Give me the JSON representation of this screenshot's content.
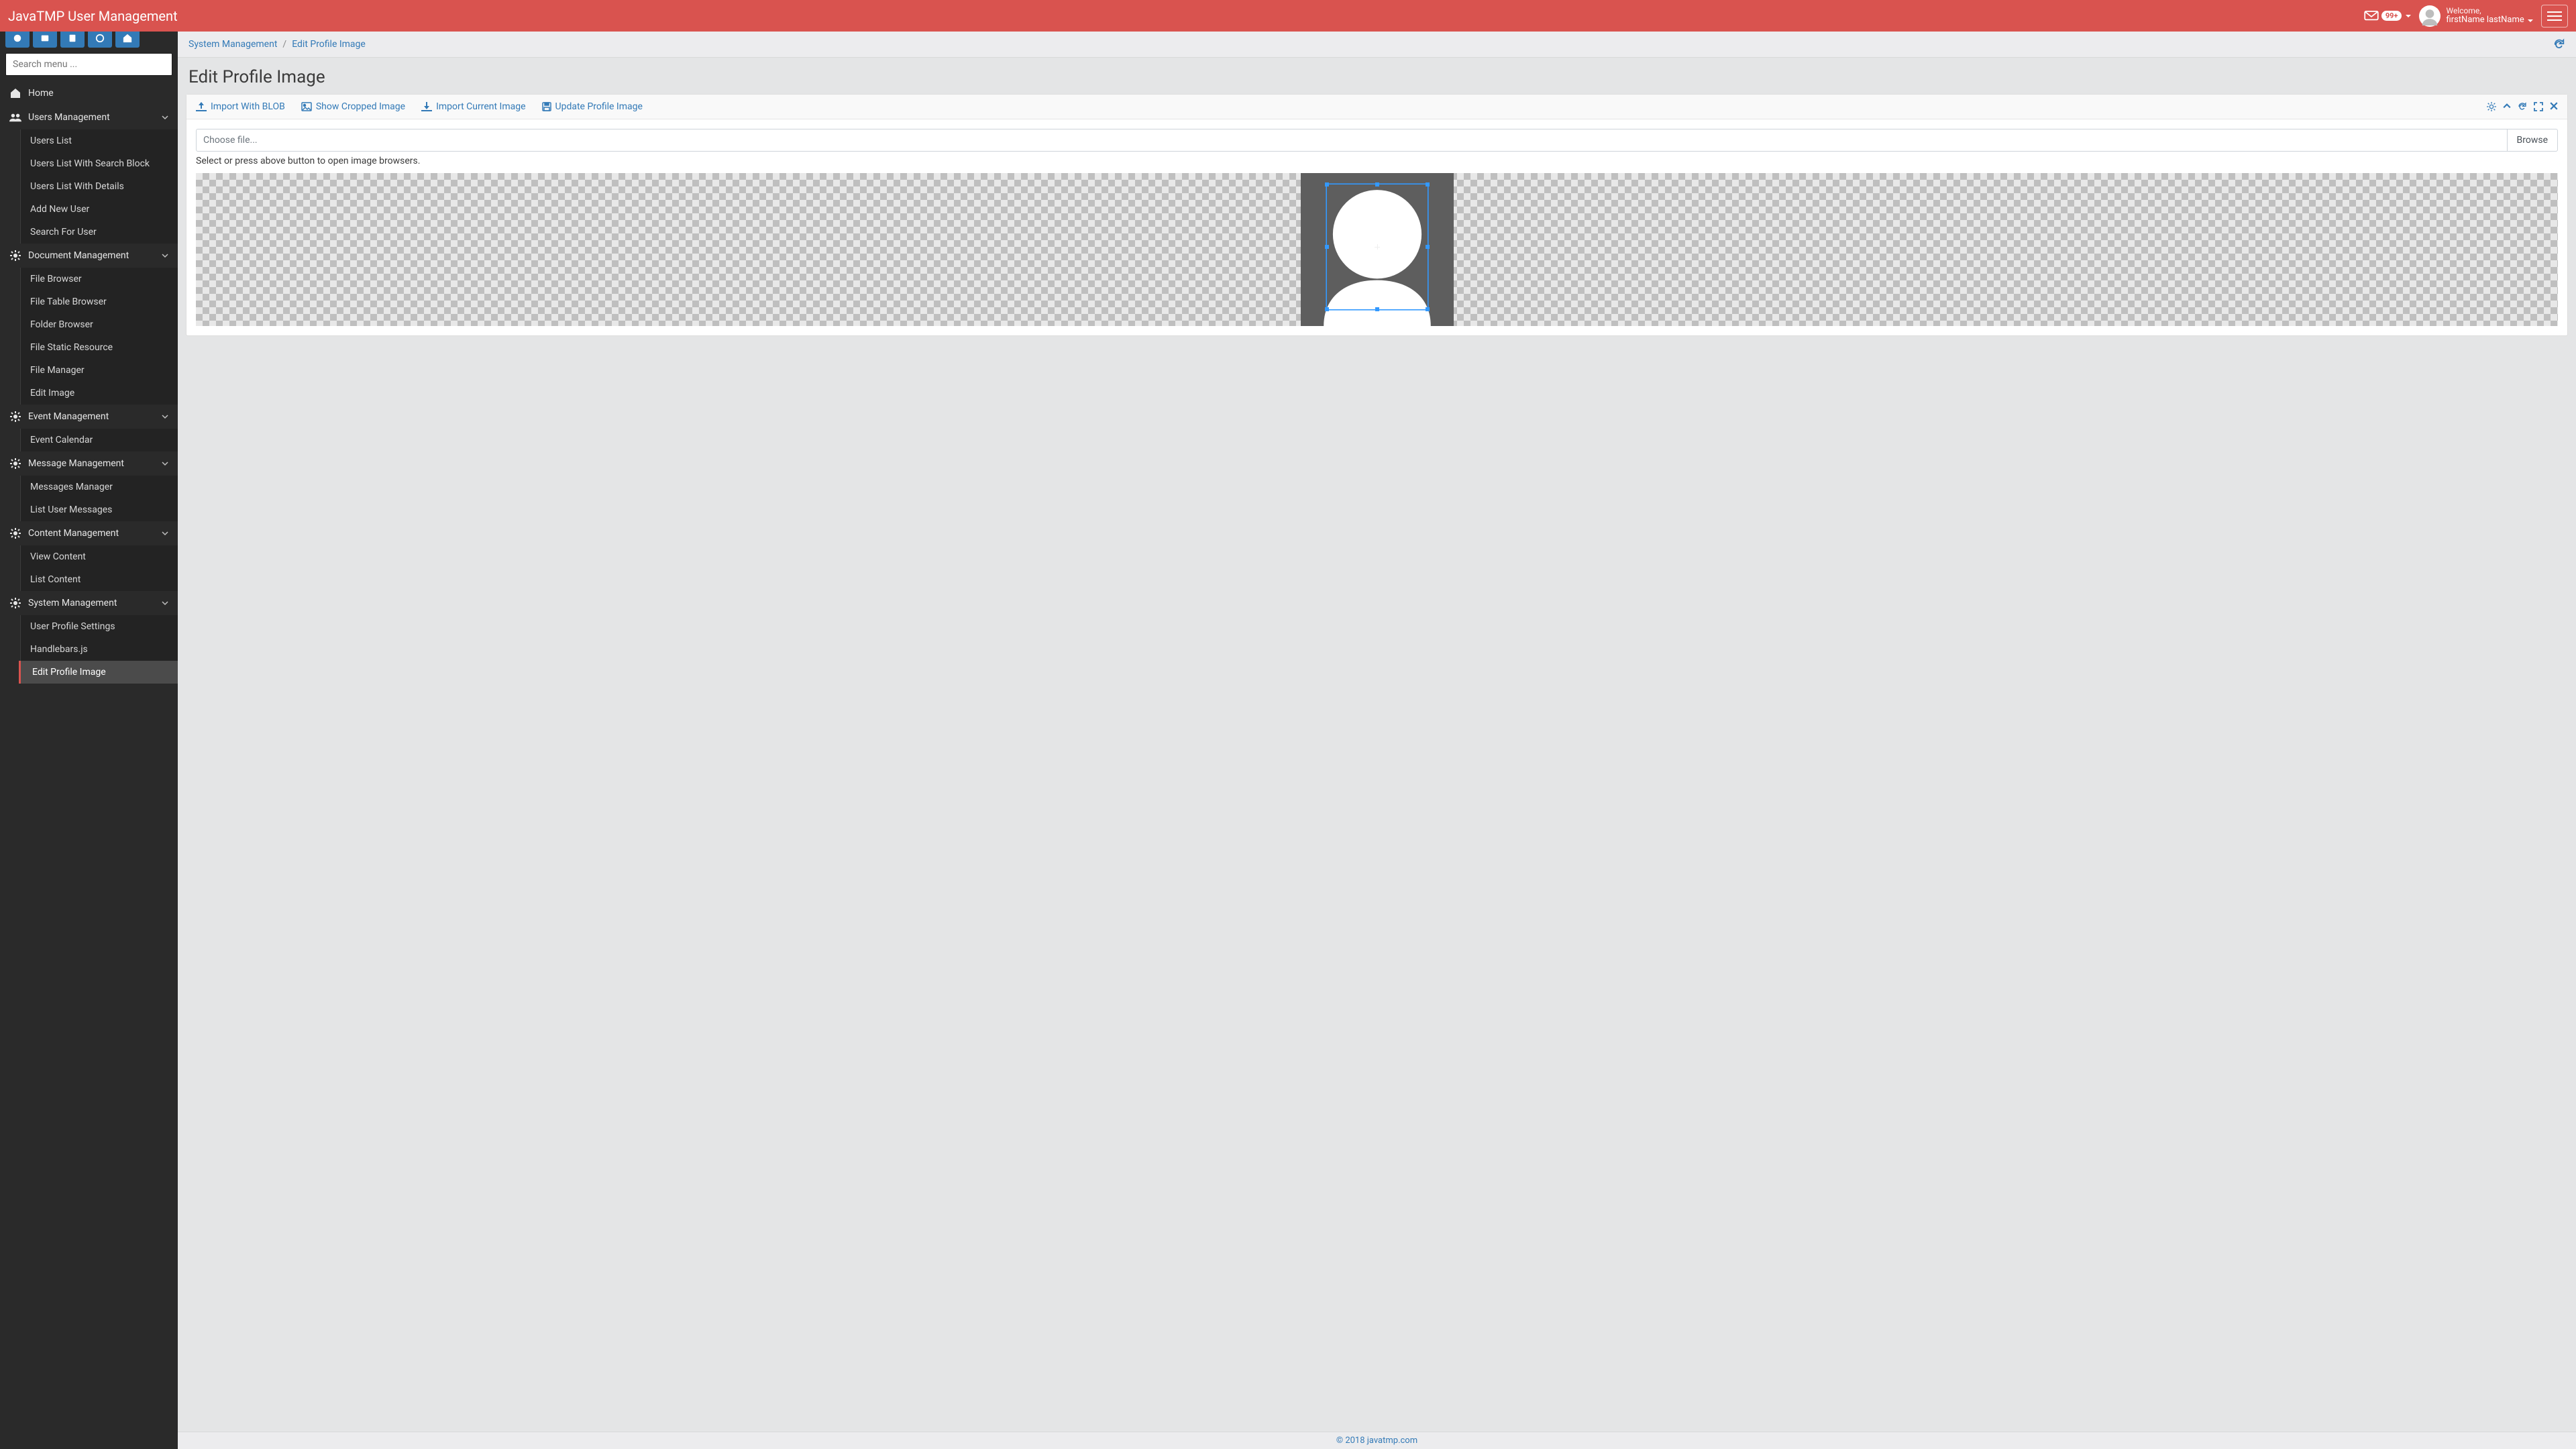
{
  "navbar": {
    "brand": "JavaTMP User Management",
    "mail_badge": "99+",
    "welcome": "Welcome,",
    "username": "firstName lastName"
  },
  "sidebar": {
    "search_placeholder": "Search menu ...",
    "items": {
      "home": "Home",
      "users_mgmt": "Users Management",
      "users_sub": [
        "Users List",
        "Users List With Search Block",
        "Users List With Details",
        "Add New User",
        "Search For User"
      ],
      "doc_mgmt": "Document Management",
      "doc_sub": [
        "File Browser",
        "File Table Browser",
        "Folder Browser",
        "File Static Resource",
        "File Manager",
        "Edit Image"
      ],
      "event_mgmt": "Event Management",
      "event_sub": [
        "Event Calendar"
      ],
      "msg_mgmt": "Message Management",
      "msg_sub": [
        "Messages Manager",
        "List User Messages"
      ],
      "content_mgmt": "Content Management",
      "content_sub": [
        "View Content",
        "List Content"
      ],
      "sys_mgmt": "System Management",
      "sys_sub": [
        "User Profile Settings",
        "Handlebars.js",
        "Edit Profile Image"
      ]
    }
  },
  "breadcrumb": {
    "root": "System Management",
    "current": "Edit Profile Image"
  },
  "page": {
    "title": "Edit Profile Image"
  },
  "card": {
    "actions": {
      "import_blob": "Import With BLOB",
      "show_cropped": "Show Cropped Image",
      "import_current": "Import Current Image",
      "update_profile": "Update Profile Image"
    },
    "file_placeholder": "Choose file...",
    "browse": "Browse",
    "hint": "Select or press above button to open image browsers."
  },
  "footer": {
    "text": "© 2018 javatmp.com"
  }
}
